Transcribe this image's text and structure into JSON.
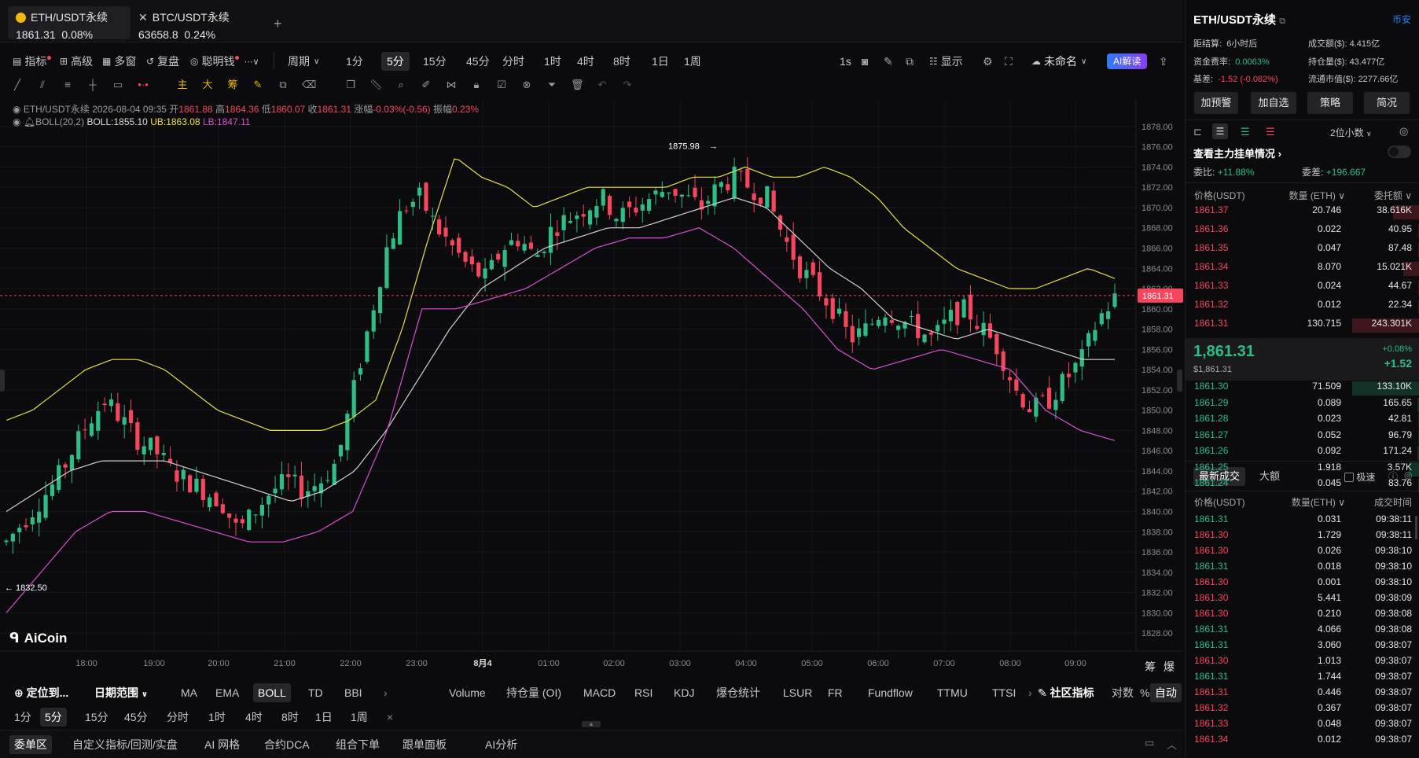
{
  "tabs": [
    {
      "symbol": "ETH/USDT永续",
      "price": "1861.31",
      "change": "0.08%"
    },
    {
      "symbol": "BTC/USDT永续",
      "price": "63658.8",
      "change": "0.24%"
    }
  ],
  "add_tab": "+",
  "toolbar": {
    "indicators": "指标",
    "advanced": "高级",
    "multi": "多窗",
    "replay": "复盘",
    "smart": "聪明钱",
    "period": "周期",
    "timeframes": [
      "1分",
      "5分",
      "15分",
      "45分",
      "分时",
      "1时",
      "4时",
      "8时",
      "1日",
      "1周"
    ],
    "selected_timeframe": "5分",
    "interval_1s": "1s",
    "display": "显示",
    "unnamed": "未命名",
    "ai": "AI解读"
  },
  "draw_tools": {
    "main": "主",
    "big": "大",
    "chips": "筹"
  },
  "info": {
    "line1_name": "ETH/USDT永续",
    "datetime": "2026-08-04 09:35",
    "open_l": "开",
    "open": "1861.88",
    "high_l": "高",
    "high": "1864.36",
    "low_l": "低",
    "low": "1860.07",
    "close_l": "收",
    "close": "1861.31",
    "chg_l": "涨幅",
    "chg": "-0.03%(-0.56)",
    "amp_l": "振幅",
    "amp": "0.23%",
    "boll_name": "BOLL(20,2)",
    "boll": "BOLL:1855.10",
    "ub": "UB:1863.08",
    "lb": "LB:1847.11"
  },
  "chart_data": {
    "type": "candlestick",
    "price_axis": [
      "1878.00",
      "1876.00",
      "1874.00",
      "1872.00",
      "1870.00",
      "1868.00",
      "1866.00",
      "1864.00",
      "1862.00",
      "1860.00",
      "1858.00",
      "1856.00",
      "1854.00",
      "1852.00",
      "1850.00",
      "1848.00",
      "1846.00",
      "1844.00",
      "1842.00",
      "1840.00",
      "1838.00",
      "1836.00",
      "1834.00",
      "1832.00",
      "1830.00",
      "1828.00"
    ],
    "ylim": [
      1827,
      1879
    ],
    "time_axis": [
      "18:00",
      "19:00",
      "20:00",
      "21:00",
      "22:00",
      "23:00",
      "8月4",
      "01:00",
      "02:00",
      "03:00",
      "04:00",
      "05:00",
      "06:00",
      "07:00",
      "08:00",
      "09:00"
    ],
    "last_price": "1861.31",
    "max_label": "1875.98",
    "min_label": "1832.50",
    "closes": [
      1837,
      1839,
      1841,
      1843,
      1846,
      1849,
      1851,
      1849,
      1847,
      1846,
      1844,
      1843,
      1842,
      1841,
      1838,
      1840,
      1842,
      1843,
      1842,
      1843,
      1845,
      1852,
      1859,
      1866,
      1870,
      1871,
      1868,
      1866,
      1864,
      1863,
      1866,
      1867,
      1865,
      1868,
      1869,
      1870,
      1871,
      1869,
      1870,
      1871,
      1872,
      1871,
      1870,
      1872,
      1873,
      1872,
      1871,
      1867,
      1864,
      1862,
      1860,
      1857,
      1858,
      1860,
      1859,
      1858,
      1857,
      1859,
      1860,
      1858,
      1856,
      1852,
      1850,
      1851,
      1853,
      1855,
      1859,
      1861
    ],
    "boll_ub": [
      1849,
      1850,
      1852,
      1854,
      1855,
      1855,
      1854,
      1852,
      1850,
      1849,
      1848,
      1848,
      1848,
      1849,
      1851,
      1858,
      1867,
      1875,
      1873,
      1872,
      1870,
      1871,
      1872,
      1872,
      1872,
      1872,
      1873,
      1873,
      1874,
      1873,
      1873,
      1874,
      1873,
      1871,
      1868,
      1866,
      1864,
      1863,
      1862,
      1862,
      1863,
      1864,
      1863
    ],
    "boll_mid": [
      1840,
      1842,
      1844,
      1845,
      1845,
      1845,
      1844,
      1843,
      1842,
      1841,
      1842,
      1844,
      1848,
      1853,
      1858,
      1862,
      1864,
      1866,
      1867,
      1868,
      1868,
      1869,
      1870,
      1871,
      1870,
      1867,
      1864,
      1862,
      1859,
      1858,
      1857,
      1858,
      1857,
      1856,
      1855,
      1855
    ],
    "boll_lb": [
      1830,
      1834,
      1838,
      1840,
      1840,
      1839,
      1838,
      1837,
      1837,
      1838,
      1840,
      1848,
      1860,
      1860,
      1861,
      1862,
      1864,
      1866,
      1867,
      1867,
      1868,
      1866,
      1863,
      1860,
      1856,
      1854,
      1855,
      1856,
      1855,
      1854,
      1850,
      1848,
      1847
    ]
  },
  "watermark": "AiCoin",
  "bottom": {
    "locate": "定位到...",
    "date_range": "日期范围",
    "indicators": [
      "MA",
      "EMA",
      "BOLL",
      "TD",
      "BBI"
    ],
    "sub_indicators": [
      "Volume",
      "持仓量 (OI)",
      "MACD",
      "RSI",
      "KDJ",
      "爆仓统计",
      "LSUR",
      "FR",
      "Fundflow",
      "TTMU",
      "TTSI"
    ],
    "community": "社区指标",
    "log": "对数",
    "pct": "%",
    "auto": "自动",
    "tfs": [
      "1分",
      "5分",
      "15分",
      "45分",
      "分时",
      "1时",
      "4时",
      "8时",
      "1日",
      "1周"
    ],
    "close_x": "×",
    "chips_l": "筹",
    "burst_l": "爆",
    "panels": [
      "委单区",
      "自定义指标/回测/实盘",
      "AI 网格",
      "合约DCA",
      "组合下单",
      "跟单面板",
      "AI分析"
    ]
  },
  "right": {
    "symbol": "ETH/USDT永续",
    "exchange": "币安",
    "settle_l": "距结算:",
    "settle": "6小时后",
    "vol_l": "成交额($):",
    "vol": "4.415亿",
    "fund_l": "资金费率:",
    "fund": "0.0063%",
    "oi_l": "持仓量($):",
    "oi": "43.477亿",
    "basis_l": "基差:",
    "basis": "-1.52 (-0.082%)",
    "cap_l": "流通市值($):",
    "cap": "2277.66亿",
    "buttons": [
      "加预警",
      "加自选",
      "策略",
      "简况"
    ],
    "decimals": "2位小数",
    "book_title": "查看主力挂单情况",
    "ratio_l": "委比:",
    "ratio": "+11.88%",
    "diff_l": "委差:",
    "diff": "+196.667",
    "hdr": [
      "价格(USDT)",
      "数量 (ETH)",
      "委托额"
    ],
    "asks": [
      [
        "1861.37",
        "20.746",
        "38.616K"
      ],
      [
        "1861.36",
        "0.022",
        "40.95"
      ],
      [
        "1861.35",
        "0.047",
        "87.48"
      ],
      [
        "1861.34",
        "8.070",
        "15.021K"
      ],
      [
        "1861.33",
        "0.024",
        "44.67"
      ],
      [
        "1861.32",
        "0.012",
        "22.34"
      ],
      [
        "1861.31",
        "130.715",
        "243.301K"
      ]
    ],
    "mid_price": "1,861.31",
    "mid_usd": "$1,861.31",
    "mid_pct": "+0.08%",
    "mid_chg": "+1.52",
    "bids": [
      [
        "1861.30",
        "71.509",
        "133.10K"
      ],
      [
        "1861.29",
        "0.089",
        "165.65"
      ],
      [
        "1861.28",
        "0.023",
        "42.81"
      ],
      [
        "1861.27",
        "0.052",
        "96.79"
      ],
      [
        "1861.26",
        "0.092",
        "171.24"
      ],
      [
        "1861.25",
        "1.918",
        "3.57K"
      ],
      [
        "1861.24",
        "0.045",
        "83.76"
      ]
    ],
    "trade_tabs": [
      "最新成交",
      "大额"
    ],
    "fast": "极速",
    "trade_hdr": [
      "价格(USDT)",
      "数量(ETH)",
      "成交时间"
    ],
    "trades": [
      [
        "1861.31",
        "0.031",
        "09:38:11",
        "g"
      ],
      [
        "1861.30",
        "1.729",
        "09:38:11",
        "r"
      ],
      [
        "1861.30",
        "0.026",
        "09:38:10",
        "r"
      ],
      [
        "1861.31",
        "0.018",
        "09:38:10",
        "g"
      ],
      [
        "1861.30",
        "0.001",
        "09:38:10",
        "r"
      ],
      [
        "1861.30",
        "5.441",
        "09:38:09",
        "r"
      ],
      [
        "1861.30",
        "0.210",
        "09:38:08",
        "r"
      ],
      [
        "1861.31",
        "4.066",
        "09:38:08",
        "g"
      ],
      [
        "1861.31",
        "3.060",
        "09:38:07",
        "g"
      ],
      [
        "1861.30",
        "1.013",
        "09:38:07",
        "r"
      ],
      [
        "1861.31",
        "1.744",
        "09:38:07",
        "g"
      ],
      [
        "1861.31",
        "0.446",
        "09:38:07",
        "r"
      ],
      [
        "1861.32",
        "0.367",
        "09:38:07",
        "r"
      ],
      [
        "1861.33",
        "0.048",
        "09:38:07",
        "r"
      ],
      [
        "1861.34",
        "0.012",
        "09:38:07",
        "r"
      ]
    ]
  },
  "colors": {
    "up": "#2ebd85",
    "down": "#f6465d",
    "ub": "#e6e04a",
    "mid": "#d0d0d0",
    "lb": "#d94fd1",
    "accent": "#2f7bf5"
  }
}
